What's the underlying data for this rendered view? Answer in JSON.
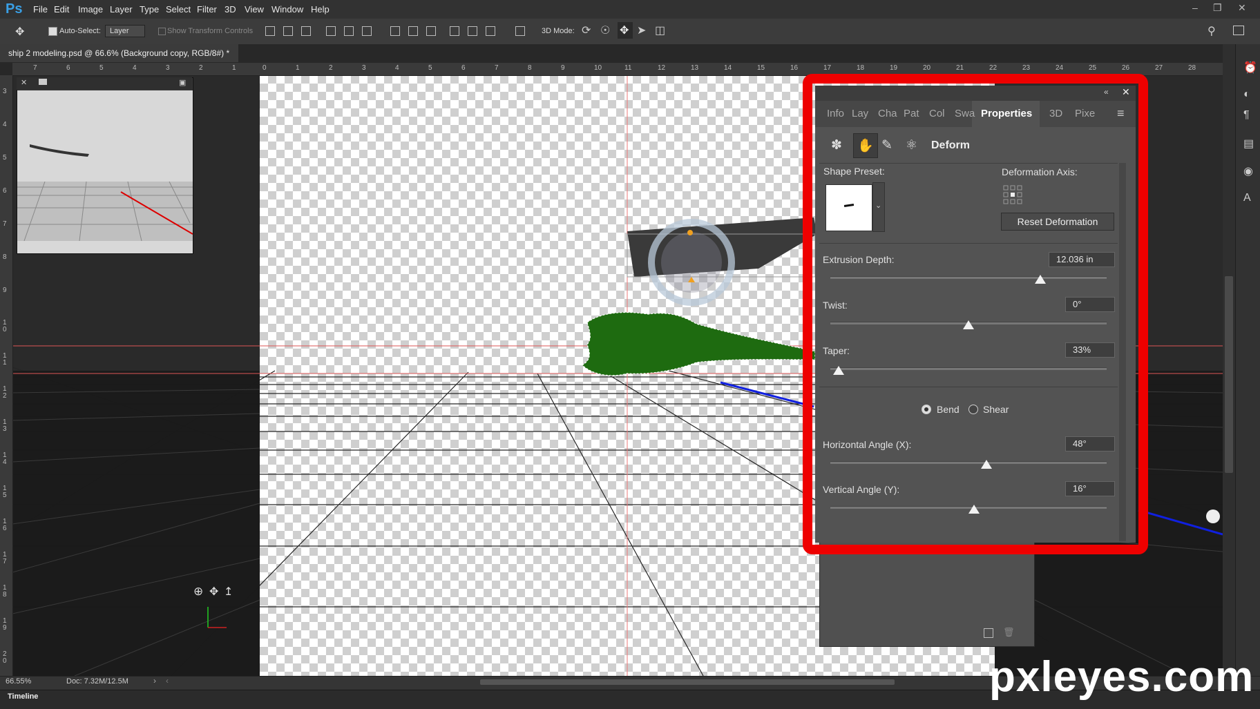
{
  "app": {
    "logo": "Ps",
    "menu": [
      "File",
      "Edit",
      "Image",
      "Layer",
      "Type",
      "Select",
      "Filter",
      "3D",
      "View",
      "Window",
      "Help"
    ]
  },
  "options": {
    "auto_select_label": "Auto-Select:",
    "auto_select_checked": true,
    "layer_select_value": "Layer",
    "show_transform_label": "Show Transform Controls",
    "mode_3d_label": "3D Mode:"
  },
  "document": {
    "tab_title": "ship 2 modeling.psd @ 66.6% (Background copy, RGB/8#) *",
    "close_glyph": "×"
  },
  "rulers": {
    "top": [
      "7",
      "6",
      "5",
      "4",
      "3",
      "2",
      "1",
      "0",
      "1",
      "2",
      "3",
      "4",
      "5",
      "6",
      "7",
      "8",
      "9",
      "10",
      "11",
      "12",
      "13",
      "14",
      "15",
      "16",
      "17",
      "18",
      "19",
      "20",
      "21",
      "22",
      "23",
      "24",
      "25",
      "26",
      "27",
      "28"
    ],
    "left": [
      "3",
      "4",
      "5",
      "6",
      "7",
      "8",
      "9",
      "1 0",
      "1 1",
      "1 2",
      "1 3",
      "1 4",
      "1 5",
      "1 6",
      "1 7",
      "1 8",
      "1 9",
      "2 0"
    ]
  },
  "properties_panel": {
    "tabs": [
      "Info",
      "Lay",
      "Cha",
      "Pat",
      "Col",
      "Swa",
      "Properties",
      "3D",
      "Pixe"
    ],
    "active_tab": "Properties",
    "section_title": "Deform",
    "shape_preset_label": "Shape Preset:",
    "deformation_axis_label": "Deformation Axis:",
    "reset_button": "Reset Deformation",
    "extrusion_depth": {
      "label": "Extrusion Depth:",
      "value": "12.036 in",
      "slider_level": 0.76
    },
    "twist": {
      "label": "Twist:",
      "value": "0°",
      "slider_level": 0.5
    },
    "taper": {
      "label": "Taper:",
      "value": "33%",
      "slider_level": 0.03
    },
    "bend_label": "Bend",
    "shear_label": "Shear",
    "bend_selected": true,
    "horizontal_angle": {
      "label": "Horizontal Angle (X):",
      "value": "48°",
      "slider_level": 0.565
    },
    "vertical_angle": {
      "label": "Vertical Angle (Y):",
      "value": "16°",
      "slider_level": 0.52
    }
  },
  "status": {
    "zoom": "66.55%",
    "doc_size": "Doc: 7.32M/12.5M"
  },
  "timeline_label": "Timeline",
  "watermark": "pxleyes.com",
  "colors": {
    "highlight_frame": "#ee0000",
    "green_shape": "#1e6b10",
    "panel_bg": "#535353"
  }
}
